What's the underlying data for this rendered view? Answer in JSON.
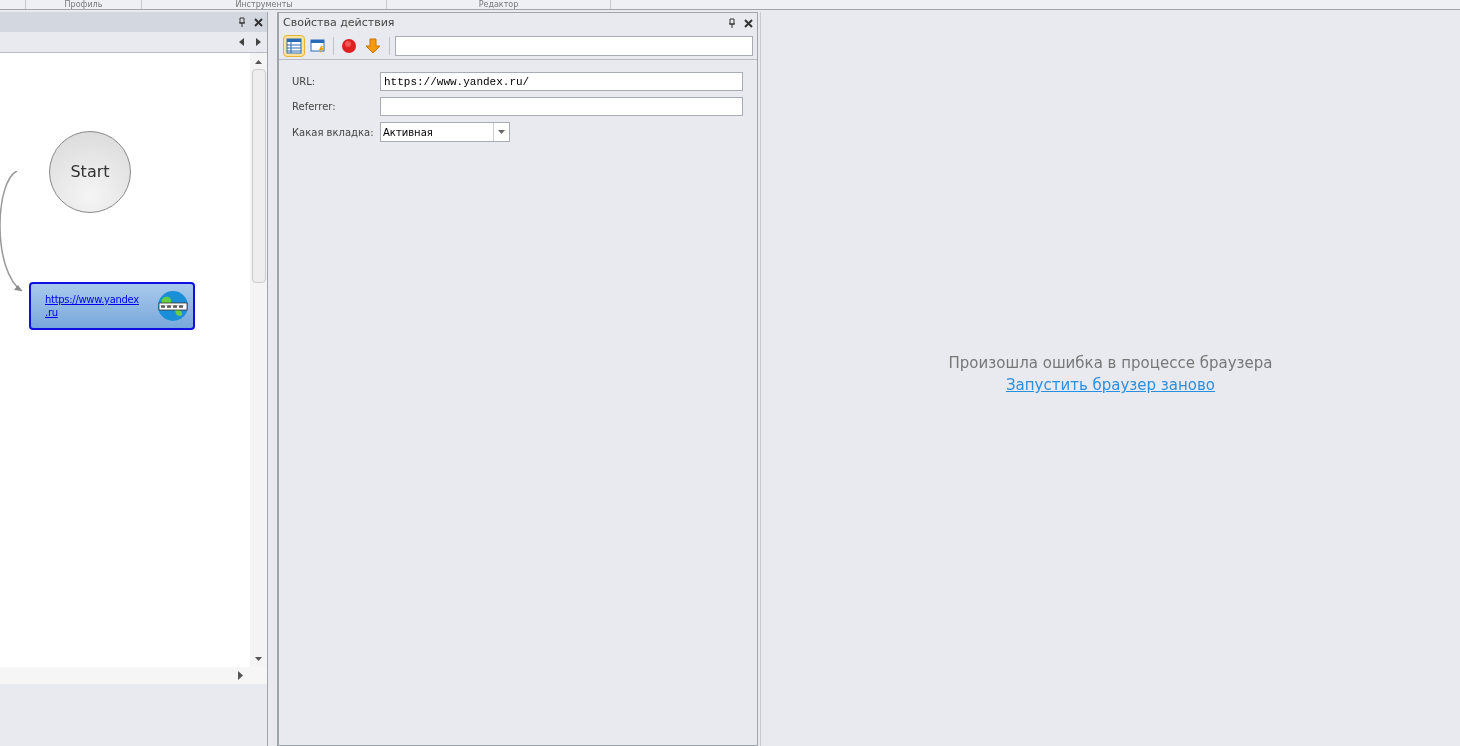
{
  "ribbon_groups": [
    "Профиль",
    "Инструменты",
    "Редактор"
  ],
  "canvas": {
    "nodes": [
      {
        "kind": "start",
        "label": "Start"
      },
      {
        "kind": "url",
        "label": "https://www.yandex\n.ru"
      }
    ]
  },
  "properties": {
    "title": "Свойства действия",
    "toolbar": [
      {
        "kind": "table",
        "selected": true
      },
      {
        "kind": "window",
        "selected": false
      },
      {
        "kind": "stop",
        "selected": false
      },
      {
        "kind": "down",
        "selected": false
      }
    ],
    "fields": [
      {
        "label": "URL:",
        "kind": "text",
        "value": "https://www.yandex.ru/"
      },
      {
        "label": "Referrer:",
        "kind": "text"
      },
      {
        "label": "Какая вкладка:",
        "kind": "select",
        "value": "Активная"
      }
    ]
  },
  "browser": {
    "message": "Произошла ошибка в процессе браузера",
    "link": "Запустить браузер заново"
  }
}
